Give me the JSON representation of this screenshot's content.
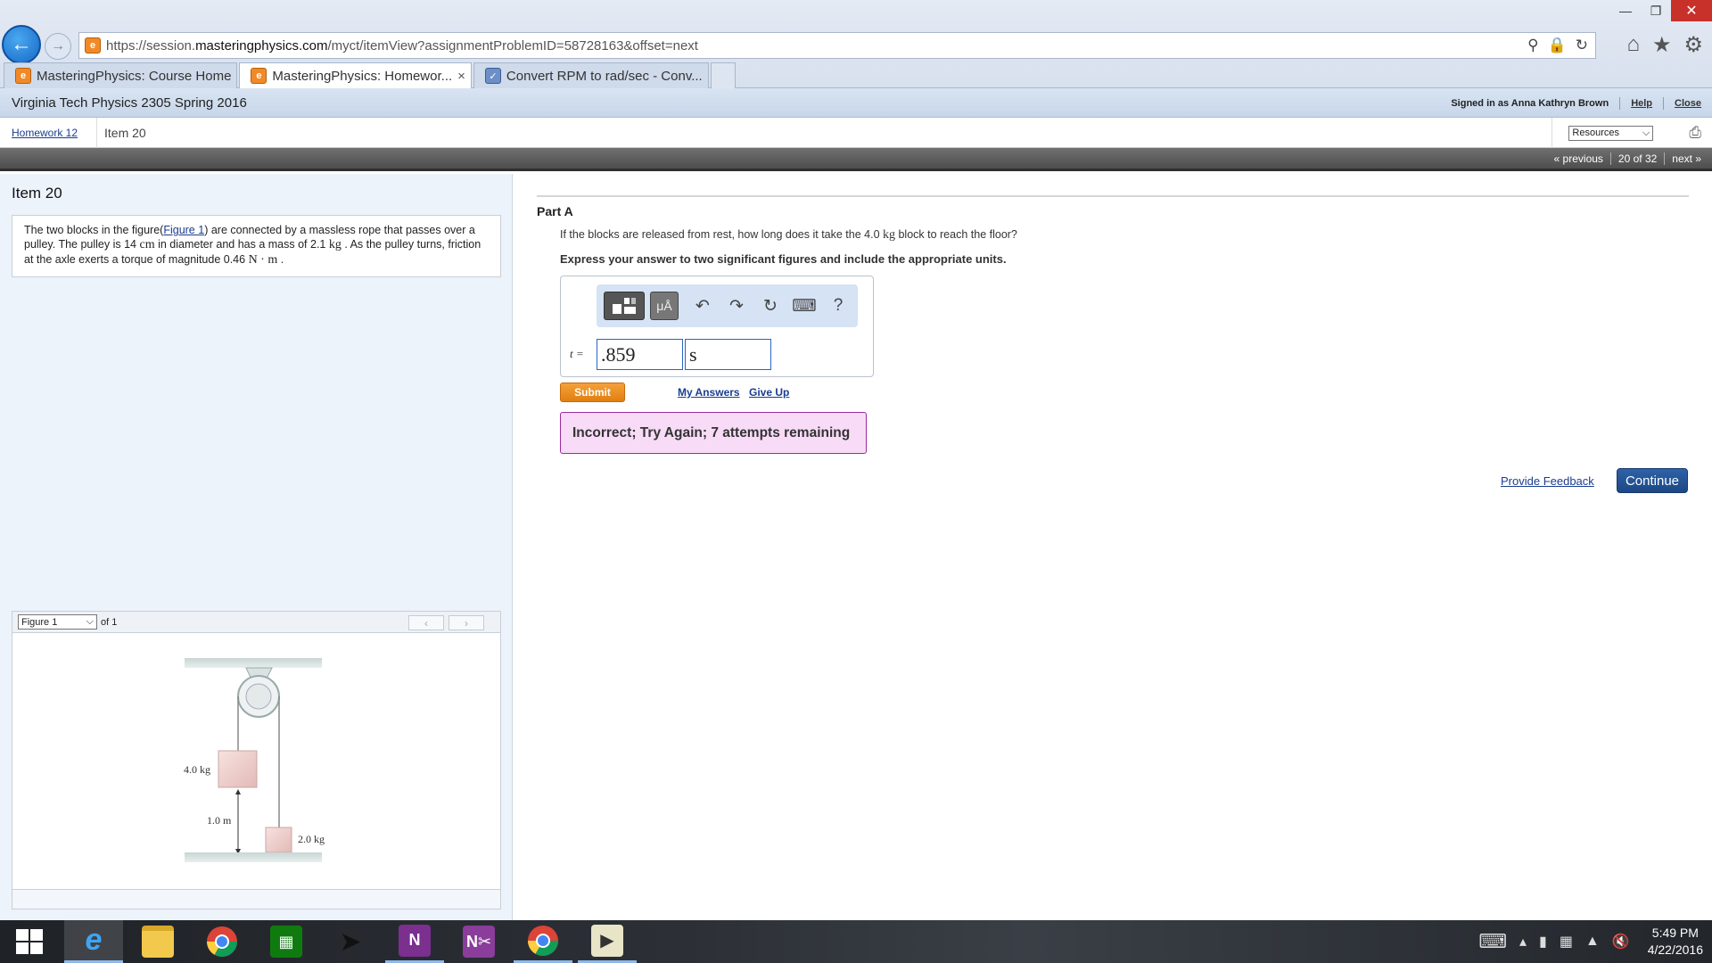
{
  "browser": {
    "url_prefix": "https://session.",
    "url_domain": "masteringphysics.com",
    "url_path": "/myct/itemView?assignmentProblemID=58728163&offset=next",
    "tabs": [
      {
        "label": "MasteringPhysics: Course Home"
      },
      {
        "label": "MasteringPhysics: Homewor..."
      },
      {
        "label": "Convert RPM to rad/sec - Conv..."
      }
    ],
    "tab_close": "×"
  },
  "header": {
    "course_title": "Virginia Tech Physics 2305 Spring 2016",
    "signed_in": "Signed in as Anna Kathryn Brown",
    "help": "Help",
    "close": "Close"
  },
  "breadcrumb": {
    "homework": "Homework 12",
    "current": "Item 20",
    "resources": "Resources"
  },
  "pager": {
    "previous": "« previous",
    "position": "20 of 32",
    "next": "next »"
  },
  "left": {
    "item_title": "Item 20",
    "problem": {
      "p1": "The two blocks in the figure(",
      "figure_link": "Figure 1",
      "p2": ") are connected by a massless rope that passes over a pulley. The pulley is 14 ",
      "u1": "cm",
      "p3": " in diameter and has a mass of 2.1 ",
      "u2": "kg",
      "p4": " . As the pulley turns, friction at the axle exerts a torque of magnitude 0.46 ",
      "u3": "N · m",
      "p5": " ."
    },
    "figure": {
      "selected": "Figure 1",
      "of": "of 1",
      "mass_a": "4.0 kg",
      "distance": "1.0 m",
      "mass_b": "2.0 kg"
    }
  },
  "part": {
    "title": "Part A",
    "question_pre": "If the blocks are released from rest, how long does it take the 4.0 ",
    "question_unit": "kg",
    "question_post": " block to reach the floor?",
    "instruction": "Express your answer to two significant figures and include the appropriate units.",
    "answer_label": "t =",
    "answer_value": ".859",
    "answer_units": "s",
    "units_btn": "μÅ",
    "help_btn": "?",
    "submit": "Submit",
    "my_answers": "My Answers",
    "give_up": "Give Up",
    "feedback": "Incorrect; Try Again; 7 attempts remaining",
    "provide_feedback": "Provide Feedback",
    "continue": "Continue"
  },
  "taskbar": {
    "time": "5:49 PM",
    "date": "4/22/2016"
  }
}
